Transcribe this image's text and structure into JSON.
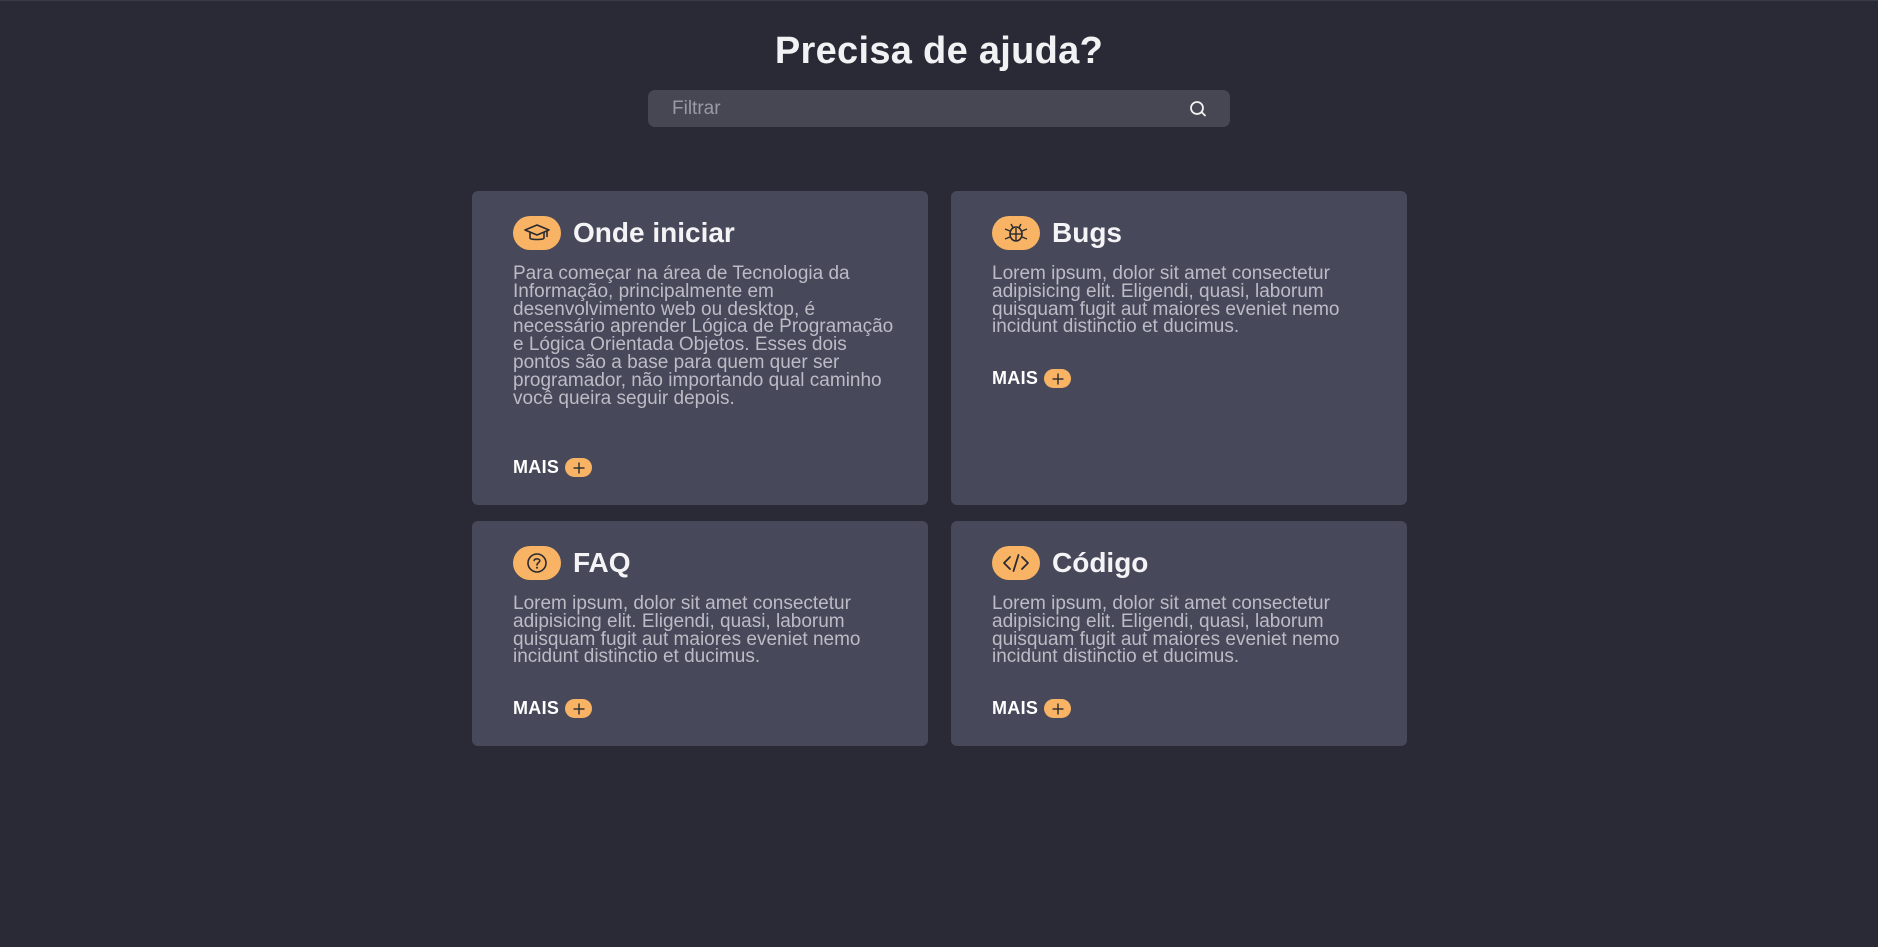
{
  "header": {
    "title": "Precisa de ajuda?"
  },
  "search": {
    "placeholder": "Filtrar",
    "icon": "search-icon"
  },
  "accent_color": "#f8b464",
  "cards": [
    {
      "title": "Onde iniciar",
      "icon": "graduation-cap-icon",
      "text": "Para começar na área de Tecnologia da Informação, principalmente em desenvolvimento web ou desktop, é necessário aprender Lógica de Programação e Lógica Orientada Objetos. Esses dois pontos são a base para quem quer ser programador, não importando qual caminho você queira seguir depois.",
      "more_label": "MAIS"
    },
    {
      "title": "Bugs",
      "icon": "bug-icon",
      "text": "Lorem ipsum, dolor sit amet consectetur adipisicing elit. Eligendi, quasi, laborum quisquam fugit aut maiores eveniet nemo incidunt distinctio et ducimus.",
      "more_label": "MAIS"
    },
    {
      "title": "FAQ",
      "icon": "question-circle-icon",
      "text": "Lorem ipsum, dolor sit amet consectetur adipisicing elit. Eligendi, quasi, laborum quisquam fugit aut maiores eveniet nemo incidunt distinctio et ducimus.",
      "more_label": "MAIS"
    },
    {
      "title": "Código",
      "icon": "code-icon",
      "text": "Lorem ipsum, dolor sit amet consectetur adipisicing elit. Eligendi, quasi, laborum quisquam fugit aut maiores eveniet nemo incidunt distinctio et ducimus.",
      "more_label": "MAIS"
    }
  ]
}
